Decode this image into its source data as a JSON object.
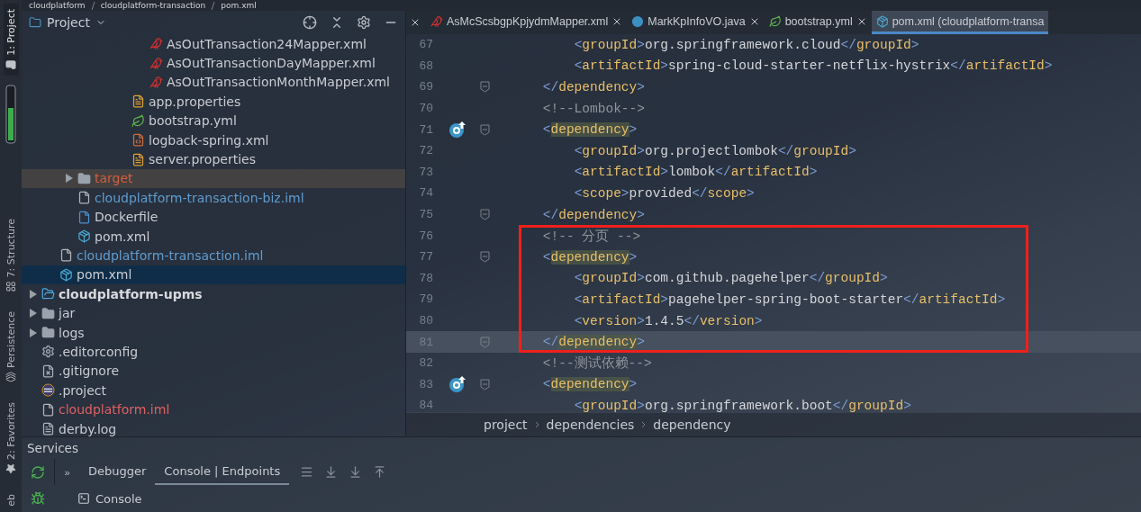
{
  "breadcrumb": [
    "cloudplatform",
    "cloudplatform-transaction",
    "pom.xml"
  ],
  "tool_strip": [
    {
      "label": "1: Project",
      "selected": true
    },
    {
      "label": "7: Structure",
      "selected": false
    },
    {
      "label": "Persistence",
      "selected": false
    },
    {
      "label": "2: Favorites",
      "selected": false
    },
    {
      "label": "eb",
      "selected": false
    }
  ],
  "project": {
    "title": "Project",
    "tree": [
      {
        "children": [
          {
            "children": [
              {
                "children": [
                  {
                    "children": [
                      {
                        "children": [
                          {
                            "children": [
                              {
                                "label": "AsOutTransaction24Mapper.xml",
                                "kind": "mapper",
                                "color": "#c9ccd2",
                                "bold": false,
                                "excluded": false,
                                "selected": false
                              },
                              {
                                "label": "AsOutTransactionDayMapper.xml",
                                "kind": "mapper",
                                "color": "#c9ccd2",
                                "bold": false,
                                "excluded": false,
                                "selected": false
                              },
                              {
                                "label": "AsOutTransactionMonthMapper.xml",
                                "kind": "mapper",
                                "color": "#c9ccd2",
                                "bold": false,
                                "excluded": false,
                                "selected": false
                              }
                            ]
                          },
                          {
                            "label": "app.properties",
                            "kind": "properties",
                            "color": "#c9ccd2",
                            "bold": false,
                            "excluded": false,
                            "selected": false
                          },
                          {
                            "label": "bootstrap.yml",
                            "kind": "yml",
                            "color": "#c9ccd2",
                            "bold": false,
                            "excluded": false,
                            "selected": false
                          },
                          {
                            "label": "logback-spring.xml",
                            "kind": "logback",
                            "color": "#c9ccd2",
                            "bold": false,
                            "excluded": false,
                            "selected": false
                          },
                          {
                            "label": "server.properties",
                            "kind": "properties",
                            "color": "#c9ccd2",
                            "bold": false,
                            "excluded": false,
                            "selected": false
                          }
                        ]
                      }
                    ]
                  }
                ]
              },
              {
                "label": "target",
                "kind": "folder",
                "color": "#d0603f",
                "bold": false,
                "excluded": true,
                "selected": false,
                "expanded": false
              },
              {
                "label": "cloudplatform-transaction-biz.iml",
                "kind": "iml",
                "color": "#5f9ccf",
                "bold": false,
                "excluded": false,
                "selected": false
              },
              {
                "label": "Dockerfile",
                "kind": "docker",
                "color": "#c9ccd2",
                "bold": false,
                "excluded": false,
                "selected": false
              },
              {
                "label": "pom.xml",
                "kind": "maven",
                "color": "#c9ccd2",
                "bold": false,
                "excluded": false,
                "selected": false
              }
            ]
          },
          {
            "label": "cloudplatform-transaction.iml",
            "kind": "iml",
            "color": "#5f9ccf",
            "bold": false,
            "excluded": false,
            "selected": false
          },
          {
            "label": "pom.xml",
            "kind": "maven",
            "color": "#c9ccd2",
            "bold": false,
            "excluded": false,
            "selected": true
          }
        ]
      },
      {
        "label": "cloudplatform-upms",
        "kind": "module",
        "color": "#d8dadd",
        "bold": true,
        "excluded": false,
        "selected": false,
        "expanded": false
      },
      {
        "label": "jar",
        "kind": "folder",
        "color": "#c9ccd2",
        "bold": false,
        "excluded": false,
        "selected": false,
        "expanded": false
      },
      {
        "label": "logs",
        "kind": "folder",
        "color": "#c9ccd2",
        "bold": false,
        "excluded": false,
        "selected": false,
        "expanded": false
      },
      {
        "label": ".editorconfig",
        "kind": "gear",
        "color": "#c9ccd2",
        "bold": false,
        "excluded": false,
        "selected": false
      },
      {
        "label": ".gitignore",
        "kind": "gitignore",
        "color": "#c9ccd2",
        "bold": false,
        "excluded": false,
        "selected": false
      },
      {
        "label": ".project",
        "kind": "eclipse",
        "color": "#c9ccd2",
        "bold": false,
        "excluded": false,
        "selected": false
      },
      {
        "label": "cloudplatform.iml",
        "kind": "iml",
        "color": "#e06060",
        "bold": false,
        "excluded": false,
        "selected": false
      },
      {
        "label": "derby.log",
        "kind": "log",
        "color": "#c9ccd2",
        "bold": false,
        "excluded": false,
        "selected": false
      }
    ]
  },
  "editor": {
    "tabs": [
      {
        "label": "AsMcScsbgpKpjydmMapper.xml",
        "kind": "mapper",
        "selected": false
      },
      {
        "label": "MarkKpInfoVO.java",
        "kind": "class",
        "selected": false
      },
      {
        "label": "bootstrap.yml",
        "kind": "yml",
        "selected": false
      },
      {
        "label": "pom.xml (cloudplatform-transa",
        "kind": "maven",
        "selected": true
      }
    ],
    "blocks": [
      {
        "boxed": false,
        "lines": [
          {
            "number": "67",
            "code": "        <groupId>org.springframework.cloud</groupId>",
            "fold": false,
            "marker": false,
            "matched": false,
            "current": false
          },
          {
            "number": "68",
            "code": "        <artifactId>spring-cloud-starter-netflix-hystrix</artifactId>",
            "fold": false,
            "marker": false,
            "matched": false,
            "current": false
          },
          {
            "number": "69",
            "code": "    </dependency>",
            "fold": true,
            "marker": false,
            "matched": false,
            "current": false
          },
          {
            "number": "70",
            "code": "    <!--Lombok-->",
            "fold": false,
            "marker": false,
            "matched": false,
            "current": false
          },
          {
            "number": "71",
            "code": "    <dependency>",
            "fold": true,
            "marker": true,
            "matched": true,
            "current": false
          },
          {
            "number": "72",
            "code": "        <groupId>org.projectlombok</groupId>",
            "fold": false,
            "marker": false,
            "matched": false,
            "current": false
          },
          {
            "number": "73",
            "code": "        <artifactId>lombok</artifactId>",
            "fold": false,
            "marker": false,
            "matched": false,
            "current": false
          },
          {
            "number": "74",
            "code": "        <scope>provided</scope>",
            "fold": false,
            "marker": false,
            "matched": false,
            "current": false
          },
          {
            "number": "75",
            "code": "    </dependency>",
            "fold": true,
            "marker": false,
            "matched": false,
            "current": false
          }
        ]
      },
      {
        "boxed": true,
        "lines": [
          {
            "number": "76",
            "code": "    <!-- 分页 -->",
            "fold": false,
            "marker": false,
            "matched": false,
            "current": false
          },
          {
            "number": "77",
            "code": "    <dependency>",
            "fold": true,
            "marker": false,
            "matched": true,
            "current": false
          },
          {
            "number": "78",
            "code": "        <groupId>com.github.pagehelper</groupId>",
            "fold": false,
            "marker": false,
            "matched": false,
            "current": false
          },
          {
            "number": "79",
            "code": "        <artifactId>pagehelper-spring-boot-starter</artifactId>",
            "fold": false,
            "marker": false,
            "matched": false,
            "current": false
          },
          {
            "number": "80",
            "code": "        <version>1.4.5</version>",
            "fold": false,
            "marker": false,
            "matched": false,
            "current": false
          },
          {
            "number": "81",
            "code": "    </dependency>",
            "fold": true,
            "marker": false,
            "matched": true,
            "current": true
          }
        ]
      },
      {
        "boxed": false,
        "lines": [
          {
            "number": "82",
            "code": "    <!--测试依赖-->",
            "fold": false,
            "marker": false,
            "matched": false,
            "current": false
          },
          {
            "number": "83",
            "code": "    <dependency>",
            "fold": true,
            "marker": true,
            "matched": true,
            "current": false
          },
          {
            "number": "84",
            "code": "        <groupId>org.springframework.boot</groupId>",
            "fold": false,
            "marker": false,
            "matched": false,
            "current": false
          }
        ]
      }
    ],
    "path": [
      "project",
      "dependencies",
      "dependency"
    ]
  },
  "services": {
    "title": "Services",
    "more": "»",
    "tabs": [
      {
        "label": "Debugger",
        "selected": false
      },
      {
        "label": "Console | Endpoints",
        "selected": true
      }
    ],
    "console": "Console"
  }
}
